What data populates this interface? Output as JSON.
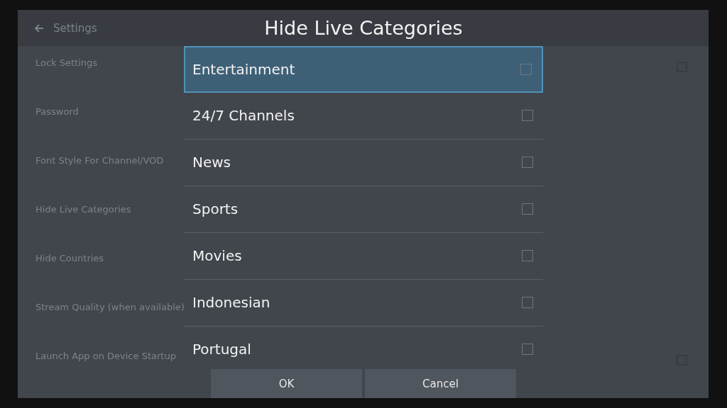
{
  "header": {
    "title": "Settings"
  },
  "settings": [
    {
      "title": "Lock Settings",
      "kind": "checkbox",
      "checked": false
    },
    {
      "title": "Password",
      "kind": "text"
    },
    {
      "title": "Font Style For Channel/VOD",
      "kind": "text"
    },
    {
      "title": "Hide Live Categories",
      "kind": "text"
    },
    {
      "title": "Hide Countries",
      "kind": "text"
    },
    {
      "title": "Stream Quality (when available)",
      "kind": "text"
    },
    {
      "title": "Launch App on Device Startup",
      "kind": "checkbox",
      "checked": false
    }
  ],
  "dialog": {
    "title": "Hide Live Categories",
    "items": [
      {
        "label": "Entertainment",
        "checked": false,
        "selected": true
      },
      {
        "label": "24/7 Channels",
        "checked": false,
        "selected": false
      },
      {
        "label": "News",
        "checked": false,
        "selected": false
      },
      {
        "label": "Sports",
        "checked": false,
        "selected": false
      },
      {
        "label": "Movies",
        "checked": false,
        "selected": false
      },
      {
        "label": "Indonesian",
        "checked": false,
        "selected": false
      },
      {
        "label": "Portugal",
        "checked": false,
        "selected": false
      }
    ],
    "buttons": [
      "OK",
      "Cancel"
    ]
  }
}
